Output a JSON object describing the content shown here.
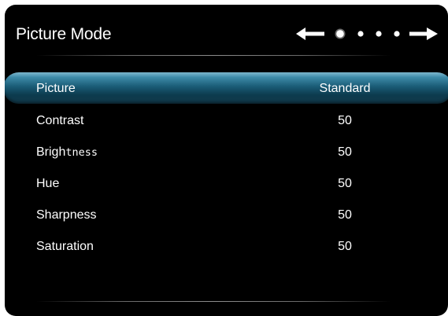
{
  "header": {
    "title": "Picture Mode",
    "pager": {
      "left_arrow": "arrow-left-icon",
      "right_arrow": "arrow-right-icon",
      "page_count": 4,
      "current_page": 1
    }
  },
  "menu": {
    "rows": [
      {
        "label_main": "Picture",
        "label_tail": "",
        "value": "Standard",
        "selected": true
      },
      {
        "label_main": "Contrast",
        "label_tail": "",
        "value": "50",
        "selected": false
      },
      {
        "label_main": "Brigh",
        "label_tail": "tness",
        "value": "50",
        "selected": false
      },
      {
        "label_main": "Hue",
        "label_tail": "",
        "value": "50",
        "selected": false
      },
      {
        "label_main": "Sharpness",
        "label_tail": "",
        "value": "50",
        "selected": false
      },
      {
        "label_main": "Saturation",
        "label_tail": "",
        "value": "50",
        "selected": false
      }
    ]
  },
  "colors": {
    "panel_bg": "#000000",
    "text": "#ffffff",
    "highlight": "#1b5d78"
  }
}
